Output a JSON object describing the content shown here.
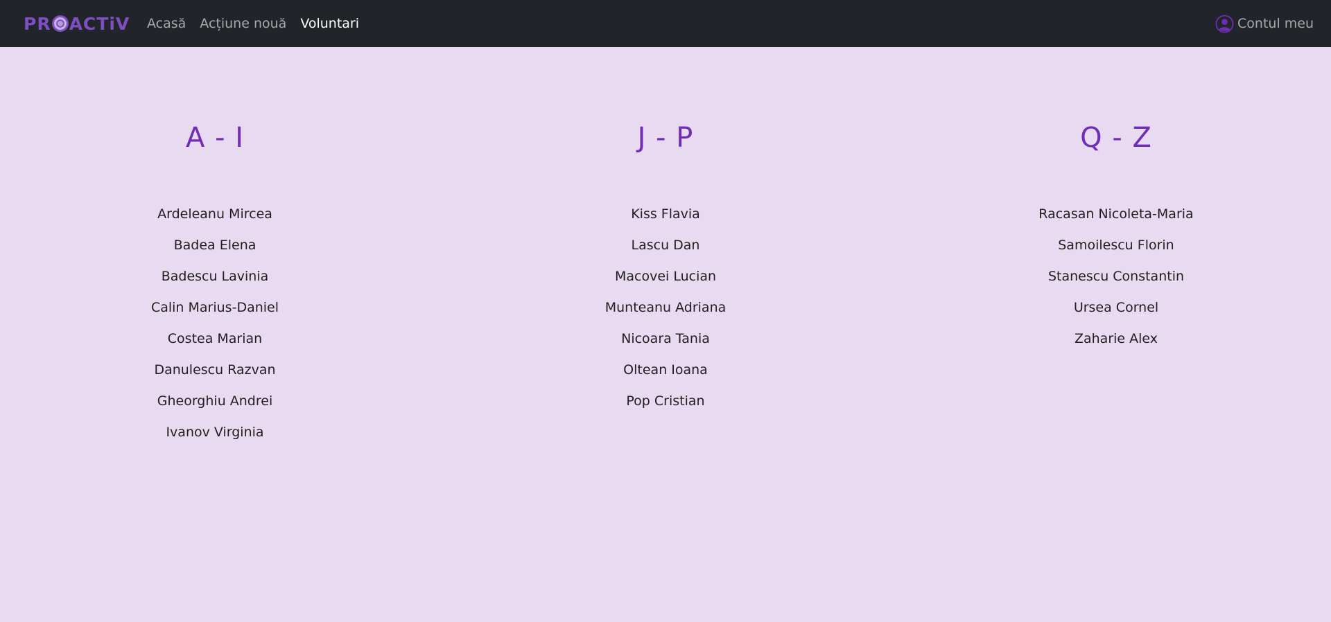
{
  "nav": {
    "brand": "PROACTIV",
    "brand_parts": [
      "PR",
      "ACTiV"
    ],
    "links": [
      {
        "label": "Acasă",
        "active": false
      },
      {
        "label": "Acțiune nouă",
        "active": false
      },
      {
        "label": "Voluntari",
        "active": true
      }
    ],
    "account_label": "Contul meu"
  },
  "colors": {
    "navbar_bg": "#212529",
    "page_bg": "#e8dbf1",
    "accent": "#6f2db8",
    "nav_link": "#a7a9ac",
    "nav_link_active": "#ffffff"
  },
  "columns": [
    {
      "title": "A - I",
      "names": [
        "Ardeleanu Mircea",
        "Badea Elena",
        "Badescu Lavinia",
        "Calin Marius-Daniel",
        "Costea Marian",
        "Danulescu Razvan",
        "Gheorghiu Andrei",
        "Ivanov Virginia"
      ]
    },
    {
      "title": "J - P",
      "names": [
        "Kiss Flavia",
        "Lascu Dan",
        "Macovei Lucian",
        "Munteanu Adriana",
        "Nicoara Tania",
        "Oltean Ioana",
        "Pop Cristian"
      ]
    },
    {
      "title": "Q - Z",
      "names": [
        "Racasan Nicoleta-Maria",
        "Samoilescu Florin",
        "Stanescu Constantin",
        "Ursea Cornel",
        "Zaharie Alex"
      ]
    }
  ]
}
